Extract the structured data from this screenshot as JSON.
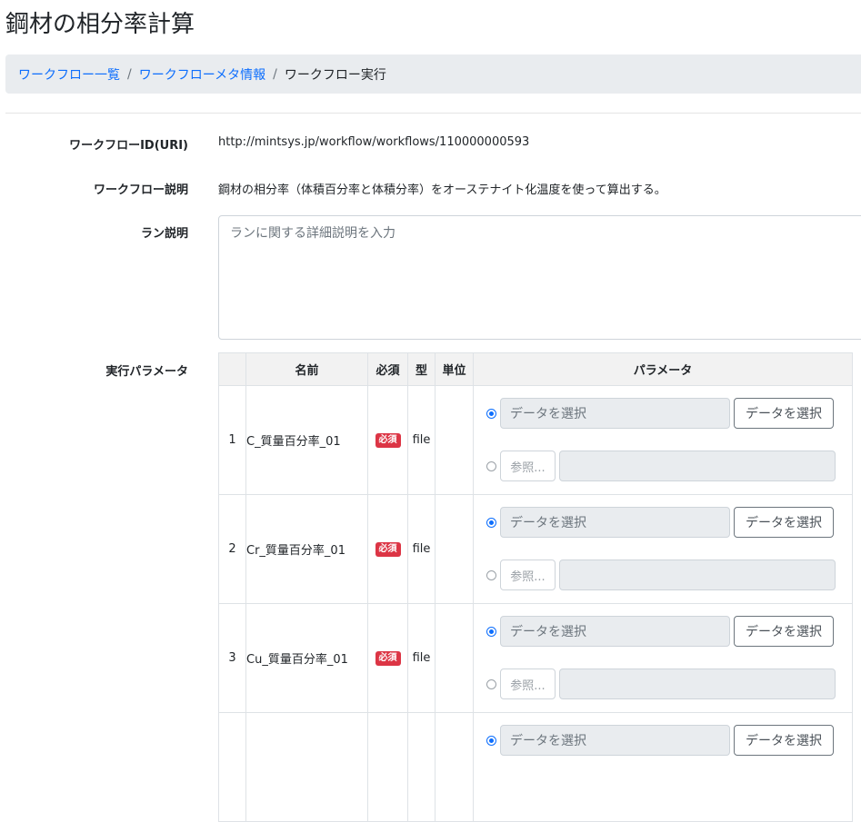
{
  "page": {
    "title": "鋼材の相分率計算"
  },
  "breadcrumb": {
    "items": [
      "ワークフロー一覧",
      "ワークフローメタ情報"
    ],
    "current": "ワークフロー実行",
    "separator": "/"
  },
  "fields": {
    "workflow_id_label": "ワークフローID(URI)",
    "workflow_id_value": "http://mintsys.jp/workflow/workflows/110000000593",
    "description_label": "ワークフロー説明",
    "description_value": "鋼材の相分率（体積百分率と体積分率）をオーステナイト化温度を使って算出する。",
    "run_description_label": "ラン説明",
    "run_description_placeholder": "ランに関する詳細説明を入力",
    "params_label": "実行パラメータ"
  },
  "table": {
    "headers": {
      "num": "",
      "name": "名前",
      "required": "必須",
      "type": "型",
      "unit": "単位",
      "param": "パラメータ"
    },
    "select_placeholder": "データを選択",
    "select_button": "データを選択",
    "ref_button": "参照...",
    "rows": [
      {
        "num": "1",
        "name": "C_質量百分率_01",
        "required": "必須",
        "type": "file",
        "unit": ""
      },
      {
        "num": "2",
        "name": "Cr_質量百分率_01",
        "required": "必須",
        "type": "file",
        "unit": ""
      },
      {
        "num": "3",
        "name": "Cu_質量百分率_01",
        "required": "必須",
        "type": "file",
        "unit": ""
      },
      {
        "num": "",
        "name": "",
        "required": "",
        "type": "",
        "unit": ""
      }
    ]
  }
}
